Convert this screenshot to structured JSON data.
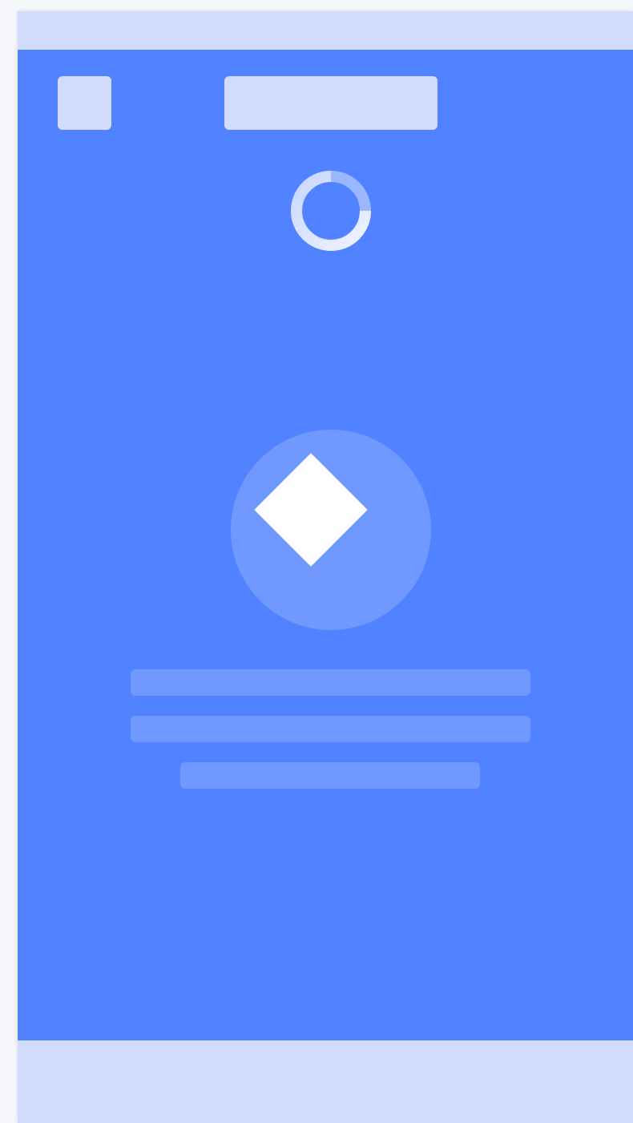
{
  "screen": {
    "state": "loading",
    "spinner_icon": "loading-spinner-icon",
    "hero_icon": "diamond-icon"
  },
  "colors": {
    "primary": "#5182ff",
    "placeholder_light": "#d1dbfc",
    "placeholder_mid": "#7198ff",
    "icon": "#ffffff"
  }
}
